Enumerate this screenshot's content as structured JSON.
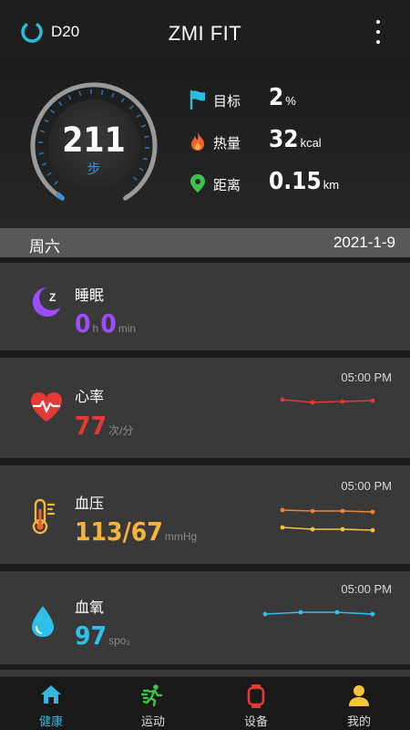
{
  "header": {
    "device_label": "D20",
    "app_title": "ZMI FIT"
  },
  "summary": {
    "steps": "211",
    "steps_unit": "步",
    "stats": [
      {
        "label": "目标",
        "value": "2",
        "unit": "%",
        "icon": "flag-icon",
        "color": "#2bbde0"
      },
      {
        "label": "热量",
        "value": "32",
        "unit": "kcal",
        "icon": "flame-icon",
        "color": "#f0652b"
      },
      {
        "label": "距离",
        "value": "0.15",
        "unit": "km",
        "icon": "location-pin-icon",
        "color": "#3cc34a"
      }
    ]
  },
  "date_bar": {
    "day": "周六",
    "date": "2021-1-9"
  },
  "cards": {
    "sleep": {
      "title": "睡眠",
      "hours": "0",
      "hours_unit": "h",
      "minutes": "0",
      "minutes_unit": "min",
      "color": "#9b4dff"
    },
    "heart_rate": {
      "title": "心率",
      "time": "05:00 PM",
      "value": "77",
      "unit": "次/分",
      "color": "#e53935"
    },
    "blood_pressure": {
      "title": "血压",
      "time": "05:00 PM",
      "value": "113/67",
      "unit": "mmHg",
      "color": "#f6b53a"
    },
    "blood_oxygen": {
      "title": "血氧",
      "time": "05:00 PM",
      "value": "97",
      "unit": "spo₂",
      "color": "#2ec0e9"
    }
  },
  "nav": {
    "items": [
      {
        "label": "健康",
        "icon": "home-icon",
        "active": true
      },
      {
        "label": "运动",
        "icon": "running-icon",
        "active": false
      },
      {
        "label": "设备",
        "icon": "watch-icon",
        "active": false
      },
      {
        "label": "我的",
        "icon": "user-icon",
        "active": false
      }
    ]
  }
}
